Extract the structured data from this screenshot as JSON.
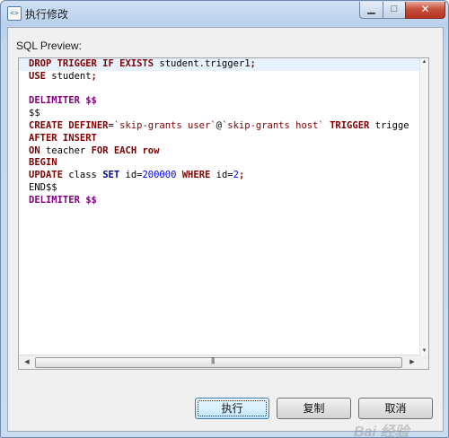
{
  "window": {
    "title": "执行修改",
    "app_icon": "<>",
    "min_glyph": "▁",
    "max_glyph": "□",
    "close_glyph": "✕"
  },
  "preview": {
    "label": "SQL Preview:",
    "lines": [
      [
        {
          "t": "DROP TRIGGER IF EXISTS",
          "c": "kw"
        },
        {
          "t": " student.trigger1",
          "c": ""
        },
        {
          "t": ";",
          "c": "kw"
        }
      ],
      [
        {
          "t": "USE",
          "c": "kw"
        },
        {
          "t": " student",
          "c": ""
        },
        {
          "t": ";",
          "c": "kw"
        }
      ],
      [],
      [
        {
          "t": "DELIMITER $$",
          "c": "kwp"
        }
      ],
      [
        {
          "t": "$$",
          "c": ""
        }
      ],
      [
        {
          "t": "CREATE DEFINER",
          "c": "kw"
        },
        {
          "t": "=",
          "c": ""
        },
        {
          "t": "`skip-grants user`",
          "c": "str"
        },
        {
          "t": "@",
          "c": ""
        },
        {
          "t": "`skip-grants host`",
          "c": "str"
        },
        {
          "t": " TRIGGER",
          "c": "kw"
        },
        {
          "t": " trigge",
          "c": ""
        }
      ],
      [
        {
          "t": "AFTER INSERT",
          "c": "kw"
        }
      ],
      [
        {
          "t": "ON",
          "c": "kw"
        },
        {
          "t": " teacher ",
          "c": ""
        },
        {
          "t": "FOR EACH",
          "c": "kw"
        },
        {
          "t": " row",
          "c": "kw"
        }
      ],
      [
        {
          "t": "BEGIN",
          "c": "kw"
        }
      ],
      [
        {
          "t": "UPDATE",
          "c": "kw"
        },
        {
          "t": " class ",
          "c": ""
        },
        {
          "t": "SET",
          "c": "kw2"
        },
        {
          "t": " id=",
          "c": ""
        },
        {
          "t": "200000",
          "c": "num"
        },
        {
          "t": " WHERE",
          "c": "kw"
        },
        {
          "t": " id=",
          "c": ""
        },
        {
          "t": "2",
          "c": "num"
        },
        {
          "t": ";",
          "c": "kw"
        }
      ],
      [
        {
          "t": "END$$",
          "c": ""
        }
      ],
      [
        {
          "t": "DELIMITER $$",
          "c": "kwp"
        }
      ]
    ],
    "scroll_grip": "|||"
  },
  "buttons": {
    "execute": "执行",
    "copy": "复制",
    "cancel": "取消"
  },
  "watermark": "Bai 经验"
}
